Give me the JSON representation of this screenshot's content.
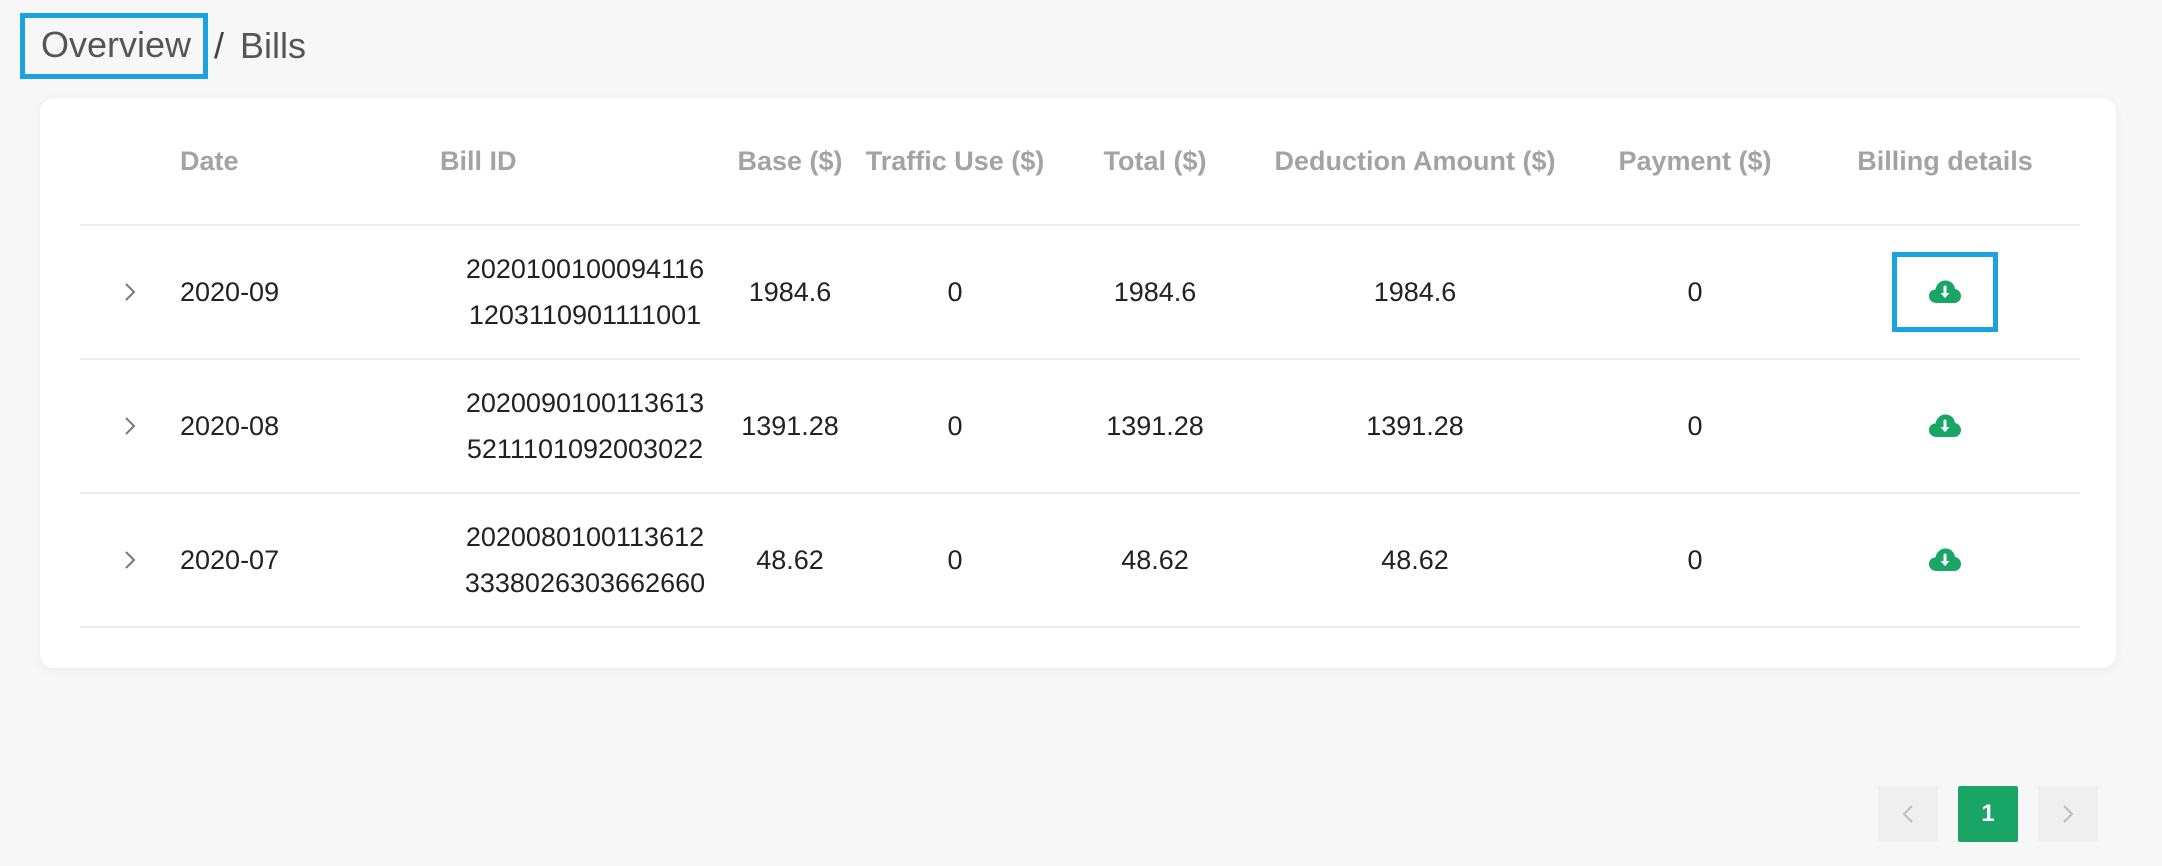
{
  "breadcrumb": {
    "root": "Overview",
    "separator": "/",
    "current": "Bills"
  },
  "table": {
    "headers": [
      "",
      "Date",
      "Bill ID",
      "Base ($)",
      "Traffic Use ($)",
      "Total ($)",
      "Deduction Amount ($)",
      "Payment ($)",
      "Billing details"
    ],
    "rows": [
      {
        "date": "2020-09",
        "bill_id_line1": "2020100100094116",
        "bill_id_line2": "1203110901111001",
        "base": "1984.6",
        "traffic": "0",
        "total": "1984.6",
        "deduction": "1984.6",
        "payment": "0"
      },
      {
        "date": "2020-08",
        "bill_id_line1": "2020090100113613",
        "bill_id_line2": "5211101092003022",
        "base": "1391.28",
        "traffic": "0",
        "total": "1391.28",
        "deduction": "1391.28",
        "payment": "0"
      },
      {
        "date": "2020-07",
        "bill_id_line1": "2020080100113612",
        "bill_id_line2": "3338026303662660",
        "base": "48.62",
        "traffic": "0",
        "total": "48.62",
        "deduction": "48.62",
        "payment": "0"
      }
    ]
  },
  "pagination": {
    "current_page": "1",
    "prev_icon": "chevron-left-icon",
    "next_icon": "chevron-right-icon"
  },
  "colors": {
    "accent_green": "#18a566",
    "highlight_blue": "#1aa3e0",
    "header_text": "#a3a3a3"
  },
  "icons": {
    "expand": "chevron-right-icon",
    "download": "cloud-download-icon"
  }
}
